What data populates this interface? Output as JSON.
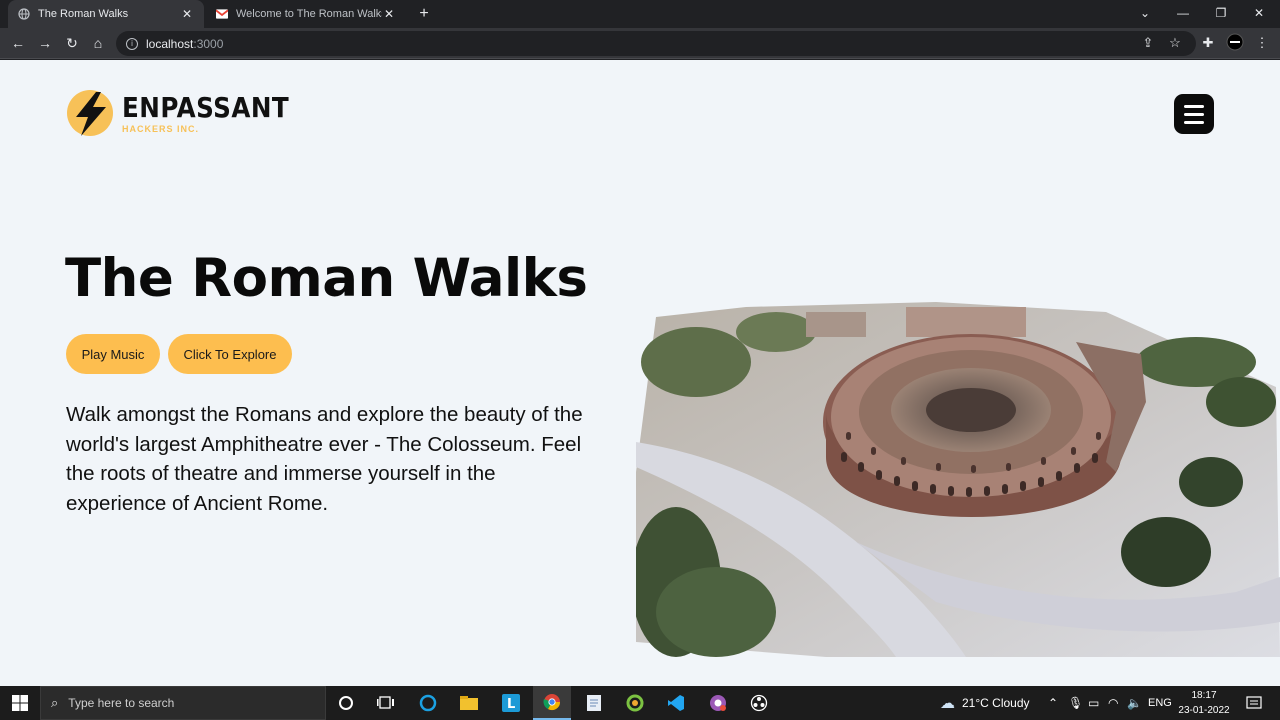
{
  "browser": {
    "tabs": [
      {
        "title": "The Roman Walks",
        "active": true
      },
      {
        "title": "Welcome to The Roman Walks!!!",
        "active": false
      }
    ],
    "new_tab": "+",
    "url_host": "localhost",
    "url_port": ":3000",
    "window_controls": {
      "minimize": "—",
      "restore": "❐",
      "close": "✕"
    }
  },
  "page": {
    "logo": {
      "name": "ENPASSANT",
      "subtitle": "HACKERS INC."
    },
    "hero": {
      "title": "The Roman Walks",
      "play_music": "Play Music",
      "explore": "Click To Explore",
      "description": "Walk amongst the Romans and explore the beauty of the world's largest Amphitheatre ever - The Colosseum. Feel the roots of theatre and immerse yourself in the experience of Ancient Rome."
    },
    "colors": {
      "accent": "#fdbe4f",
      "background": "#f1f5f9",
      "text": "#0a0a0a"
    }
  },
  "taskbar": {
    "search_placeholder": "Type here to search",
    "weather": "21°C  Cloudy",
    "language": "ENG",
    "time": "18:17",
    "date": "23-01-2022",
    "apps": [
      "task-view-icon",
      "cortana-icon",
      "file-explorer-icon",
      "app-l-icon",
      "chrome-icon",
      "notepad-icon",
      "chameleon-app-icon",
      "vscode-icon",
      "chrome-profile-icon",
      "obs-icon"
    ]
  }
}
